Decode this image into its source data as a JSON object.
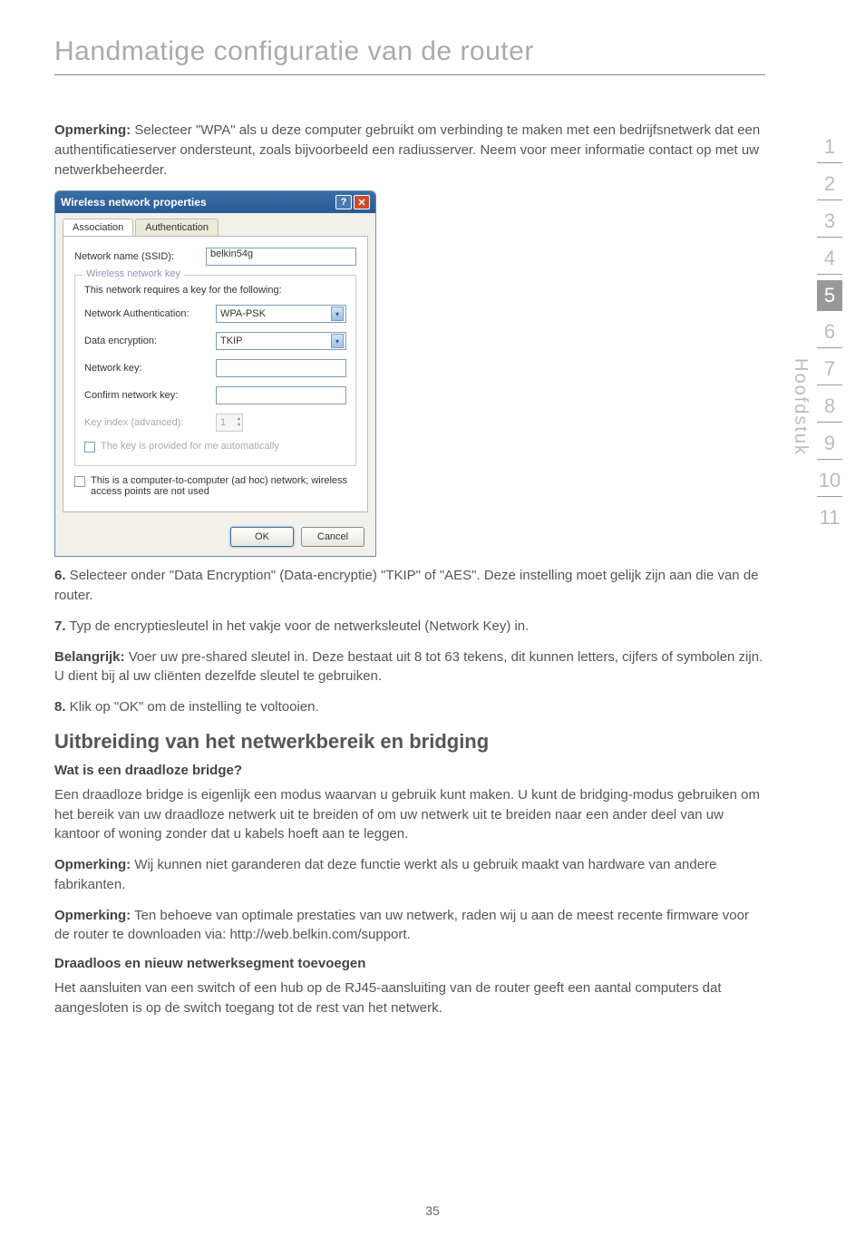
{
  "page_title": "Handmatige configuratie van de router",
  "paragraphs": {
    "opmerking1_label": "Opmerking:",
    "opmerking1_text": " Selecteer \"WPA\" als u deze computer gebruikt om verbinding te maken met een bedrijfsnetwerk dat een authentificatieserver ondersteunt, zoals bijvoorbeeld een radiusserver. Neem voor meer informatie contact op met uw netwerkbeheerder.",
    "step6_label": "6.",
    "step6_text": " Selecteer onder \"Data Encryption\" (Data-encryptie) \"TKIP\" of \"AES\". Deze instelling moet gelijk zijn aan die van de router.",
    "step7_label": "7.",
    "step7_text": " Typ de encryptiesleutel in het vakje voor de netwerksleutel (Network Key) in.",
    "belangrijk_label": "Belangrijk:",
    "belangrijk_text": " Voer uw pre-shared sleutel in. Deze bestaat uit 8 tot 63 tekens, dit kunnen letters, cijfers of symbolen zijn. U dient bij al uw cliënten dezelfde sleutel te gebruiken.",
    "step8_label": "8.",
    "step8_text": " Klik op \"OK\" om de instelling te voltooien.",
    "section_heading": "Uitbreiding van het netwerkbereik en bridging",
    "sub_heading1": "Wat is een draadloze bridge?",
    "bridge_text": "Een draadloze bridge is eigenlijk een modus waarvan u gebruik kunt maken. U kunt de bridging-modus gebruiken om het bereik van uw draadloze netwerk uit te breiden of om uw netwerk uit te breiden naar een ander deel van uw kantoor of woning zonder dat u kabels hoeft aan te leggen.",
    "opmerking2_label": "Opmerking:",
    "opmerking2_text": " Wij kunnen niet garanderen dat deze functie werkt als u gebruik maakt van hardware van andere fabrikanten.",
    "opmerking3_label": "Opmerking:",
    "opmerking3_text": " Ten behoeve van optimale prestaties van uw netwerk, raden wij u aan de meest recente firmware voor de router te downloaden via: http://web.belkin.com/support.",
    "sub_heading2": "Draadloos en nieuw netwerksegment toevoegen",
    "segment_text": "Het aansluiten van een switch of een hub op de RJ45-aansluiting van de router geeft een aantal computers dat aangesloten is op de switch toegang tot de rest van het netwerk."
  },
  "dialog": {
    "title": "Wireless network properties",
    "tab_association": "Association",
    "tab_authentication": "Authentication",
    "ssid_label": "Network name (SSID):",
    "ssid_value": "belkin54g",
    "fieldset_legend": "Wireless network key",
    "fieldset_text": "This network requires a key for the following:",
    "auth_label": "Network Authentication:",
    "auth_value": "WPA-PSK",
    "enc_label": "Data encryption:",
    "enc_value": "TKIP",
    "key_label": "Network key:",
    "confirm_label": "Confirm network key:",
    "index_label": "Key index (advanced):",
    "index_value": "1",
    "auto_key_label": "The key is provided for me automatically",
    "adhoc_label": "This is a computer-to-computer (ad hoc) network; wireless access points are not used",
    "ok_btn": "OK",
    "cancel_btn": "Cancel"
  },
  "side_nav": {
    "label": "Hoofdstuk",
    "items": [
      "1",
      "2",
      "3",
      "4",
      "5",
      "6",
      "7",
      "8",
      "9",
      "10",
      "11"
    ],
    "active_index": 4
  },
  "page_number": "35"
}
